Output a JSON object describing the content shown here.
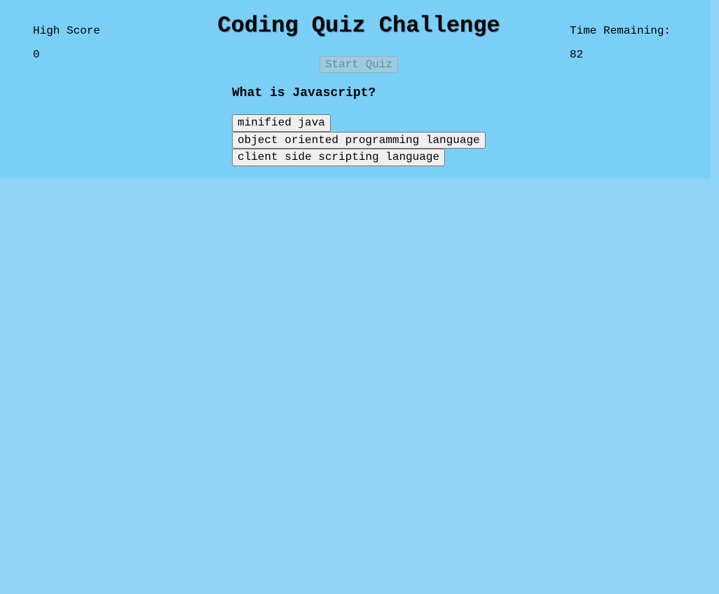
{
  "header": {
    "high_score_label": "High Score",
    "high_score_value": "0",
    "title": "Coding Quiz Challenge",
    "time_label": "Time Remaining:",
    "time_value": "82"
  },
  "controls": {
    "start_label": "Start Quiz",
    "start_disabled": true
  },
  "quiz": {
    "question": "What is Javascript?",
    "answers": [
      "minified java",
      "object oriented programming language",
      "client side scripting language"
    ]
  },
  "colors": {
    "page_background": "#8dd4f7",
    "panel_background": "#7acff7",
    "answer_button_background": "#efefef",
    "start_button_disabled_background": "#9ccbe0"
  }
}
